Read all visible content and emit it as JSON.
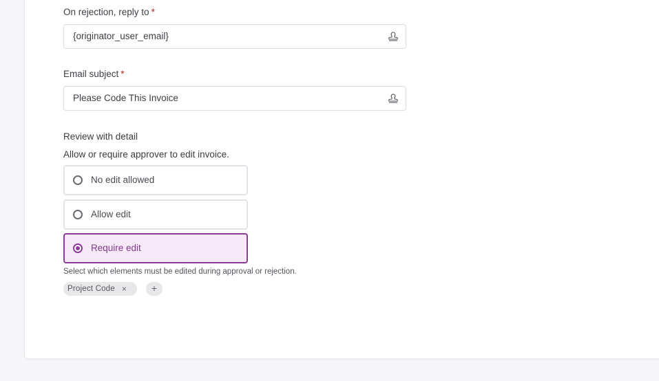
{
  "form": {
    "reply_to": {
      "label": "On rejection, reply to",
      "required_mark": "*",
      "value": "{originator_user_email}",
      "icon": "stamp-icon"
    },
    "email_subject": {
      "label": "Email subject",
      "required_mark": "*",
      "value": "Please Code This Invoice",
      "icon": "stamp-icon"
    },
    "review": {
      "heading": "Review with detail",
      "description": "Allow or require approver to edit invoice.",
      "options": [
        {
          "label": "No edit allowed",
          "selected": false
        },
        {
          "label": "Allow edit",
          "selected": false
        },
        {
          "label": "Require edit",
          "selected": true
        }
      ],
      "hint": "Select which elements must be edited during approval or rejection.",
      "chips": [
        {
          "label": "Project Code",
          "remove_icon": "×"
        }
      ],
      "add_icon": "+"
    }
  },
  "colors": {
    "accent": "#8e3a99",
    "accent_bg": "#f7e9f8",
    "required": "#b3261e"
  }
}
